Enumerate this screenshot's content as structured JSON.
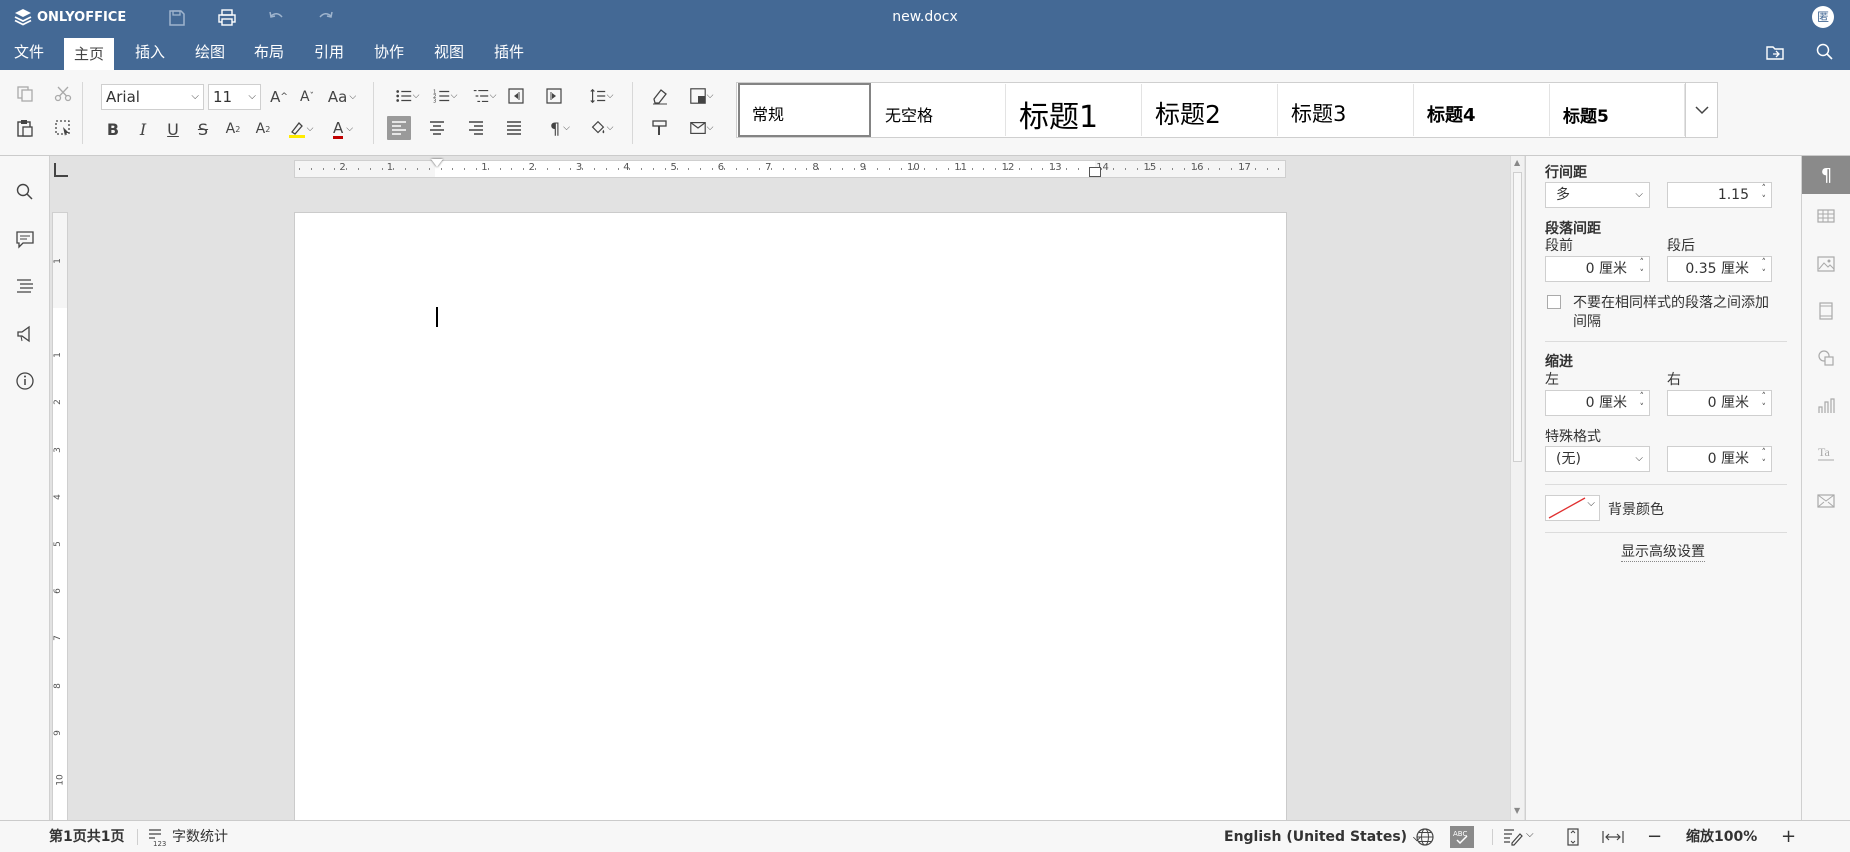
{
  "app": {
    "brand": "ONLYOFFICE",
    "filename": "new.docx",
    "user_initial": "匿"
  },
  "menu": {
    "tabs": [
      "文件",
      "主页",
      "插入",
      "绘图",
      "布局",
      "引用",
      "协作",
      "视图",
      "插件"
    ],
    "active": "主页"
  },
  "toolbar": {
    "font_name": "Arial",
    "font_size": "11",
    "styles": [
      "常规",
      "无空格",
      "标题1",
      "标题2",
      "标题3",
      "标题4",
      "标题5"
    ]
  },
  "ruler": {
    "horizontal_ticks": [
      "2",
      "1",
      "1",
      "2",
      "3",
      "4",
      "5",
      "6",
      "7",
      "8",
      "9",
      "10",
      "11",
      "12",
      "13",
      "14",
      "15",
      "16",
      "17"
    ],
    "vertical_ticks": [
      "1",
      "1",
      "2",
      "3",
      "4",
      "5",
      "6",
      "7",
      "8",
      "9",
      "10"
    ]
  },
  "right_panel": {
    "line_spacing_label": "行间距",
    "line_spacing_mode": "多",
    "line_spacing_value": "1.15",
    "para_spacing_label": "段落间距",
    "before_label": "段前",
    "after_label": "段后",
    "before_value": "0 厘米",
    "after_value": "0.35 厘米",
    "no_space_checkbox_line1": "不要在相同样式的段落之间添加",
    "no_space_checkbox_line2": "间隔",
    "indent_label": "缩进",
    "left_label": "左",
    "right_label": "右",
    "left_value": "0 厘米",
    "right_value": "0 厘米",
    "special_label": "特殊格式",
    "special_value": "(无)",
    "special_amount": "0 厘米",
    "bg_color_label": "背景颜色",
    "advanced_link": "显示高级设置"
  },
  "status": {
    "page_info": "第1页共1页",
    "word_count": "字数统计",
    "language": "English (United States)",
    "zoom": "缩放100%"
  },
  "colors": {
    "accent": "#446995",
    "highlight": "#ffeb00",
    "font_color": "#c00000"
  }
}
